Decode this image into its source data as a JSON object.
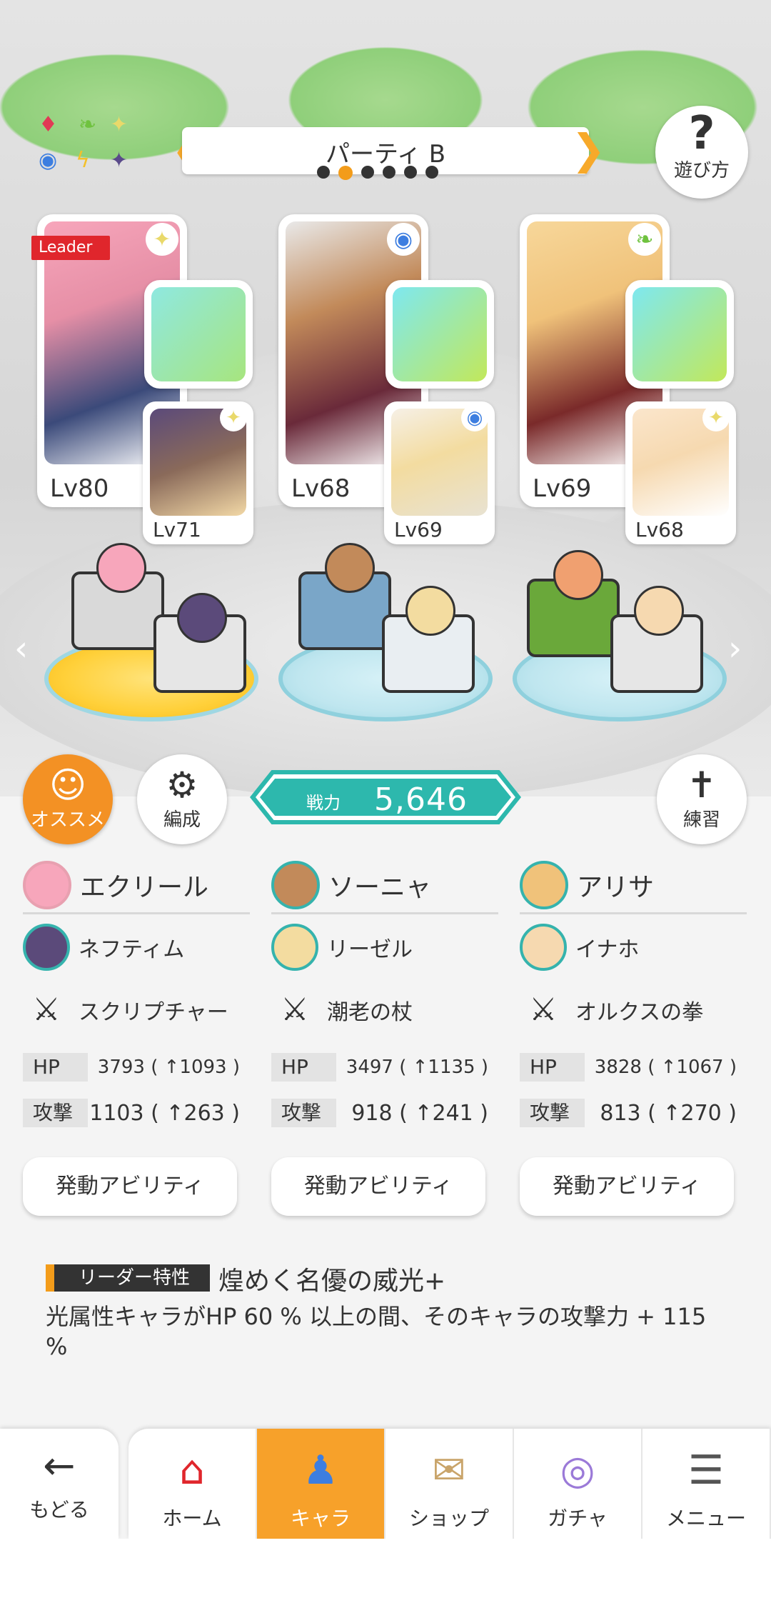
{
  "header": {
    "party_title": "パーティ B",
    "help_label": "遊び方",
    "left_arrow": "❮",
    "right_arrow": "❯"
  },
  "party": [
    {
      "leader_tag": "Leader",
      "main_level": "Lv80",
      "sub_level": "Lv71"
    },
    {
      "main_level": "Lv68",
      "sub_level": "Lv69"
    },
    {
      "main_level": "Lv69",
      "sub_level": "Lv68"
    }
  ],
  "buttons": {
    "recommend": "オススメ",
    "formation": "編成",
    "practice": "練習"
  },
  "power": {
    "label": "戦力",
    "value": "5,646"
  },
  "columns": [
    {
      "main_name": "エクリール",
      "sub_name": "ネフティム",
      "weapon": "スクリプチャー",
      "hp_label": "HP",
      "hp_value": "3793 ( ↑1093 )",
      "atk_label": "攻撃",
      "atk_value": "1103 ( ↑263 )",
      "ability": "発動アビリティ"
    },
    {
      "main_name": "ソーニャ",
      "sub_name": "リーゼル",
      "weapon": "潮老の杖",
      "hp_label": "HP",
      "hp_value": "3497 ( ↑1135 )",
      "atk_label": "攻撃",
      "atk_value": "918 ( ↑241 )",
      "ability": "発動アビリティ"
    },
    {
      "main_name": "アリサ",
      "sub_name": "イナホ",
      "weapon": "オルクスの拳",
      "hp_label": "HP",
      "hp_value": "3828 ( ↑1067 )",
      "atk_label": "攻撃",
      "atk_value": "813 ( ↑270 )",
      "ability": "発動アビリティ"
    }
  ],
  "leader_trait": {
    "tag": "リーダー特性",
    "title": "煌めく名優の威光+",
    "description": "光属性キャラがHP 60 % 以上の間、そのキャラの攻撃力 + 115 %"
  },
  "nav": {
    "back": "もどる",
    "tabs": [
      "ホーム",
      "キャラ",
      "ショップ",
      "ガチャ",
      "メニュー"
    ],
    "active_tab": "キャラ"
  },
  "colors": {
    "accent_orange": "#f39c1a",
    "teal": "#2db8ad",
    "leader_red": "#e0262c"
  }
}
